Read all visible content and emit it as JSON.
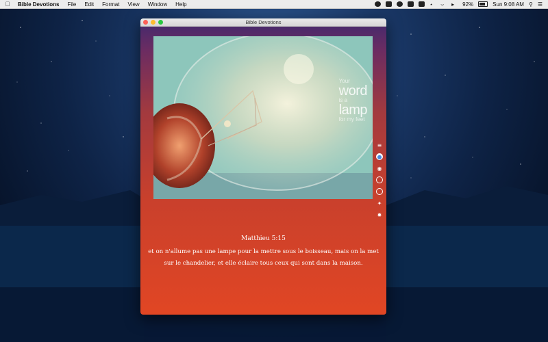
{
  "menubar": {
    "app_name": "Bible Devotions",
    "menus": [
      "File",
      "Edit",
      "Format",
      "View",
      "Window",
      "Help"
    ],
    "battery_percent": "92%",
    "clock": "Sun 9:08 AM"
  },
  "window": {
    "title": "Bible Devotions"
  },
  "image": {
    "overlay_line1": "Your",
    "overlay_word1": "word",
    "overlay_line2": "is a",
    "overlay_word2": "lamp",
    "overlay_line3": "for my feet"
  },
  "verse": {
    "reference": "Matthieu 5:15",
    "line1": "et on n'allume pas une lampe pour la mettre sous le boisseau, mais on la met",
    "line2": "sur le chandelier, et elle éclaire tous ceux qui sont dans la maison."
  },
  "side_icons": [
    "share-icon",
    "safari-icon",
    "messages-icon",
    "info-icon",
    "add-icon",
    "brightness-icon",
    "settings-icon"
  ]
}
